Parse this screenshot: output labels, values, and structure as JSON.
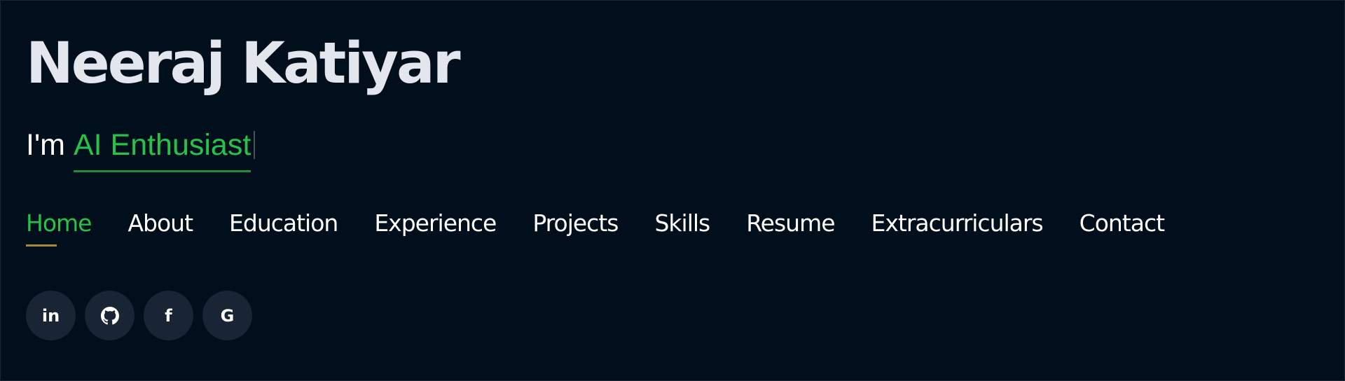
{
  "header": {
    "name": "Neeraj Katiyar",
    "tagline_prefix": "I'm",
    "tagline_role": "AI Enthusiast"
  },
  "nav": {
    "items": [
      {
        "label": "Home",
        "active": true
      },
      {
        "label": "About"
      },
      {
        "label": "Education"
      },
      {
        "label": "Experience"
      },
      {
        "label": "Projects"
      },
      {
        "label": "Skills"
      },
      {
        "label": "Resume"
      },
      {
        "label": "Extracurriculars"
      },
      {
        "label": "Contact"
      }
    ]
  },
  "socials": {
    "linkedin_icon_text": "in",
    "facebook_icon_text": "f",
    "google_icon_text": "G",
    "icons": [
      "linkedin-icon",
      "github-icon",
      "facebook-icon",
      "google-icon"
    ]
  },
  "colors": {
    "background": "#010e1b",
    "name_text": "#e3e6ec",
    "accent_green": "#26c24a",
    "active_underline": "#a58a3b",
    "social_button_bg": "#192434"
  }
}
